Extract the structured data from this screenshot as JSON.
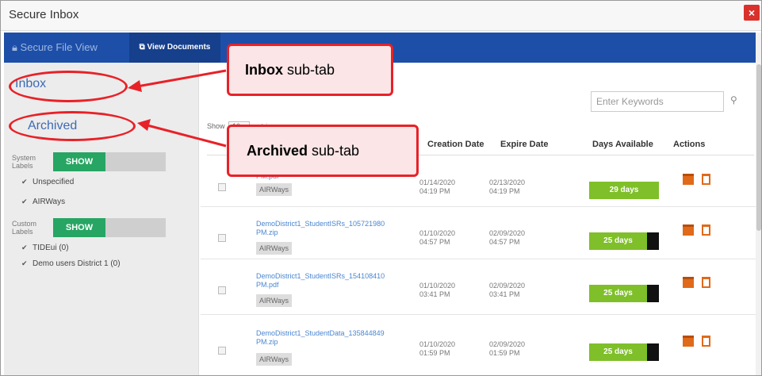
{
  "window": {
    "title": "Secure Inbox",
    "close_glyph": "×"
  },
  "nav": {
    "tabs": [
      {
        "label": "Secure File View",
        "icon": "lock-icon"
      },
      {
        "label": "View Documents",
        "icon": "docs-icon"
      }
    ]
  },
  "sidebar": {
    "inbox": "Inbox",
    "archived": "Archived",
    "system_labels": {
      "caption": "System Labels",
      "toggle": "SHOW",
      "items": [
        "Unspecified",
        "AIRWays"
      ]
    },
    "custom_labels": {
      "caption": "Custom Labels",
      "toggle": "SHOW",
      "items": [
        "TIDEui (0)",
        "Demo users District 1 (0)"
      ]
    }
  },
  "toolbar": {
    "show_prefix": "Show",
    "show_value": "10",
    "show_suffix": "entries",
    "search_placeholder": "Enter Keywords"
  },
  "table": {
    "columns": [
      "Creation Date",
      "Expire Date",
      "Days Available",
      "Actions"
    ],
    "rows": [
      {
        "file": "PM.pdf",
        "tag": "AIRWays",
        "created": "01/14/2020 04:19 PM",
        "expires": "02/13/2020 04:19 PM",
        "days": "29 days",
        "days_fraction": 1.0
      },
      {
        "file": "DemoDistrict1_StudentISRs_105721980 PM.zip",
        "tag": "AIRWays",
        "created": "01/10/2020 04:57 PM",
        "expires": "02/09/2020 04:57 PM",
        "days": "25 days",
        "days_fraction": 0.83
      },
      {
        "file": "DemoDistrict1_StudentISRs_154108410 PM.pdf",
        "tag": "AIRWays",
        "created": "01/10/2020 03:41 PM",
        "expires": "02/09/2020 03:41 PM",
        "days": "25 days",
        "days_fraction": 0.83
      },
      {
        "file": "DemoDistrict1_StudentData_135844849 PM.zip",
        "tag": "AIRWays",
        "created": "01/10/2020 01:59 PM",
        "expires": "02/09/2020 01:59 PM",
        "days": "25 days",
        "days_fraction": 0.83
      }
    ]
  },
  "callouts": {
    "inbox": {
      "bold": "Inbox",
      "rest": "sub-tab"
    },
    "archived": {
      "bold": "Archived",
      "rest": "sub-tab"
    }
  },
  "colors": {
    "annotation": "#e82128",
    "nav": "#1d4fa8",
    "toggle_on": "#27a563",
    "days_fill": "#7fbf2a",
    "action": "#e06a1a"
  }
}
